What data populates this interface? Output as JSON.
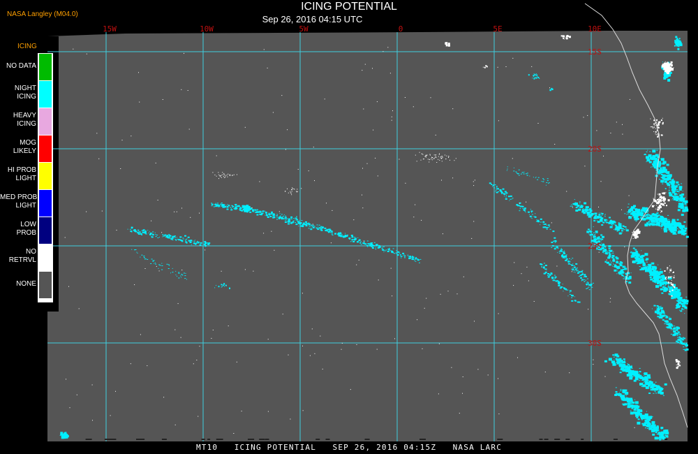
{
  "credit": "NASA Langley (M04.0)",
  "title": "ICING POTENTIAL",
  "subtitle": "Sep 26, 2016 04:15 UTC",
  "footer": "MT10   ICING POTENTIAL   SEP 26, 2016 04:15Z   NASA LARC",
  "colors": {
    "background": "#000000",
    "map_fill": "#555555",
    "grid_line": "#3fd0e0",
    "lat_label": "#c01010",
    "lon_label": "#c01010",
    "coastline": "#dddddd",
    "icing_pixels": "#00f0ff",
    "no_retrieval_pixels": "#ffffff"
  },
  "longitude_labels": [
    "15W",
    "10W",
    "5W",
    "0",
    "5E",
    "10E"
  ],
  "latitude_labels": [
    "15S",
    "20S",
    "25S",
    "30S"
  ],
  "legend": {
    "title": "ICING",
    "items": [
      {
        "label": "NO DATA",
        "color": "#00bb00"
      },
      {
        "label": "NIGHT\nICING",
        "color": "#00ffff"
      },
      {
        "label": "HEAVY\nICING",
        "color": "#e8a8e0"
      },
      {
        "label": "MOG\nLIKELY",
        "color": "#ff0000"
      },
      {
        "label": "HI PROB\nLIGHT",
        "color": "#ffff00"
      },
      {
        "label": "MED PROB\nLIGHT",
        "color": "#0000ff"
      },
      {
        "label": "LOW\nPROB",
        "color": "#000080"
      },
      {
        "label": "NO\nRETRVL",
        "color": "#ffffff"
      },
      {
        "label": "NONE",
        "color": "#555555"
      }
    ]
  }
}
